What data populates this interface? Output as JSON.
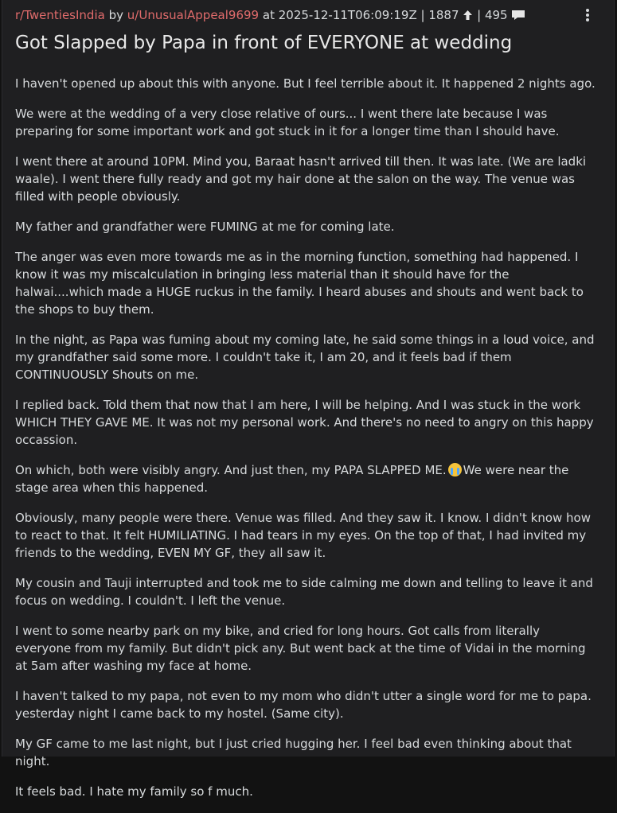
{
  "post": {
    "subreddit": "r/TwentiesIndia",
    "by": "by",
    "author": "u/UnusualAppeal9699",
    "at": "at",
    "timestamp": "2025-12-11T06:09:19Z",
    "separator": "|",
    "score": "1887",
    "comments": "495",
    "title": "Got Slapped by Papa in front of EVERYONE at wedding",
    "paragraphs": [
      "I haven't opened up about this with anyone. But I feel terrible about it. It happened 2 nights ago.",
      "We were at the wedding of a very close relative of ours... I went there late because I was preparing for some important work and got stuck in it for a longer time than I should have.",
      "I went there at around 10PM. Mind you, Baraat hasn't arrived till then. It was late. (We are ladki waale). I went there fully ready and got my hair done at the salon on the way. The venue was filled with people obviously.",
      "My father and grandfather were FUMING at me for coming late.",
      "The anger was even more towards me as in the morning function, something had happened. I know it was my miscalculation in bringing less material than it should have for the halwai....which made a HUGE ruckus in the family. I heard abuses and shouts and went back to the shops to buy them.",
      "In the night, as Papa was fuming about my coming late, he said some things in a loud voice, and my grandfather said some more. I couldn't take it, I am 20, and it feels bad if them CONTINUOUSLY Shouts on me.",
      "I replied back. Told them that now that I am here, I will be helping. And I was stuck in the work WHICH THEY GAVE ME. It was not my personal work. And there's no need to angry on this happy occassion.",
      "On which, both were visibly angry. And just then, my PAPA SLAPPED ME.",
      "We were near the stage area when this happened.",
      "Obviously, many people were there. Venue was filled. And they saw it. I know. I didn't know how to react to that. It felt HUMILIATING. I had tears in my eyes. On the top of that, I had invited my friends to the wedding, EVEN MY GF, they all saw it.",
      "My cousin and Tauji interrupted and took me to side calming me down and telling to leave it and focus on wedding. I couldn't. I left the venue.",
      "I went to some nearby park on my bike, and cried for long hours. Got calls from literally everyone from my family. But didn't pick any. But went back at the time of Vidai in the morning at 5am after washing my face at home.",
      "I haven't talked to my papa, not even to my mom who didn't utter a single word for me to papa. yesterday night I came back to my hostel. (Same city).",
      "My GF came to me last night, but I just cried hugging her. I feel bad even thinking about that night.",
      "It feels bad. I hate my family so f much."
    ]
  },
  "icons": {
    "score": "upvote-arrow-icon",
    "comments": "comment-bubble-icon",
    "more": "kebab-menu-icon",
    "emoji": "crying-face-emoji"
  },
  "colors": {
    "link": "#e06b6b",
    "text": "#d7dadc",
    "background": "#1f1f21"
  }
}
